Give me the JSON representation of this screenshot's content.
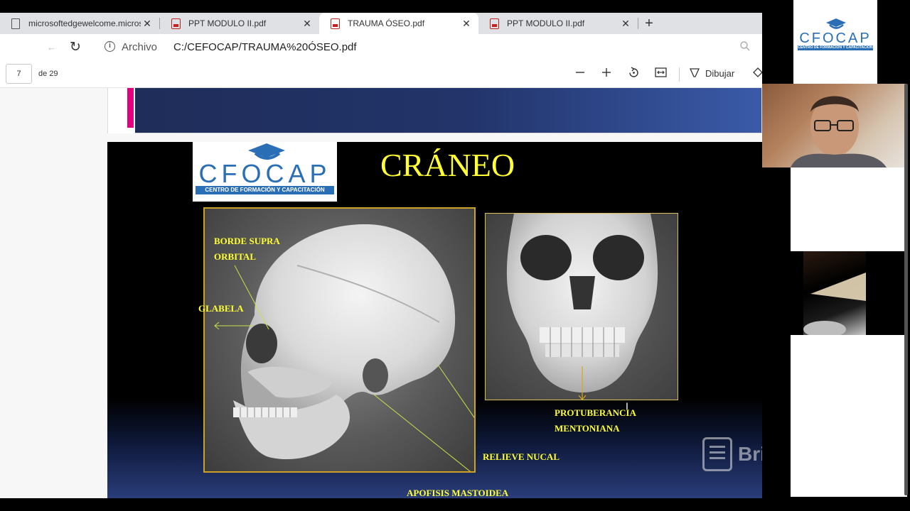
{
  "tabs": [
    {
      "label": "microsoftedgewelcome.microsoft.com",
      "icon": "page-icon",
      "close": "✕"
    },
    {
      "label": "PPT MODULO II.pdf",
      "icon": "pdf-icon",
      "close": "✕"
    },
    {
      "label": "TRAUMA ÓSEO.pdf",
      "icon": "pdf-icon",
      "close": "✕",
      "active": true
    },
    {
      "label": "PPT MODULO II.pdf",
      "icon": "pdf-icon",
      "close": "✕"
    }
  ],
  "new_tab": "+",
  "address": {
    "scheme_label": "Archivo",
    "url": "C:/CEFOCAP/TRAUMA%20ÓSEO.pdf"
  },
  "pdf_toolbar": {
    "page_current": "7",
    "page_total": "de 29",
    "draw_label": "Dibujar"
  },
  "slide": {
    "title": "CRÁNEO",
    "logo_text": "CFOCAP",
    "logo_subtitle": "CENTRO DE FORMACIÓN Y CAPACITACIÓN",
    "labels": {
      "borde_1": "BORDE SUPRA",
      "borde_2": "ORBITAL",
      "glabela": "GLABELA",
      "protuberancia_1": "PROTUBERANCIA",
      "protuberancia_2": "MENTONIANA",
      "relieve": "RELIEVE  NUCAL",
      "apofisis": "APOFISIS  MASTOIDEA"
    }
  },
  "side_logo": {
    "text": "CFOCAP",
    "subtitle": "CENTRO DE FORMACIÓN Y CAPACITACIÓN"
  },
  "watermark": "BriefP",
  "colors": {
    "slide_title": "#ffff33",
    "label": "#ffff33",
    "annotation_line": "#c8e04a",
    "logo_blue": "#2a6fb5"
  }
}
